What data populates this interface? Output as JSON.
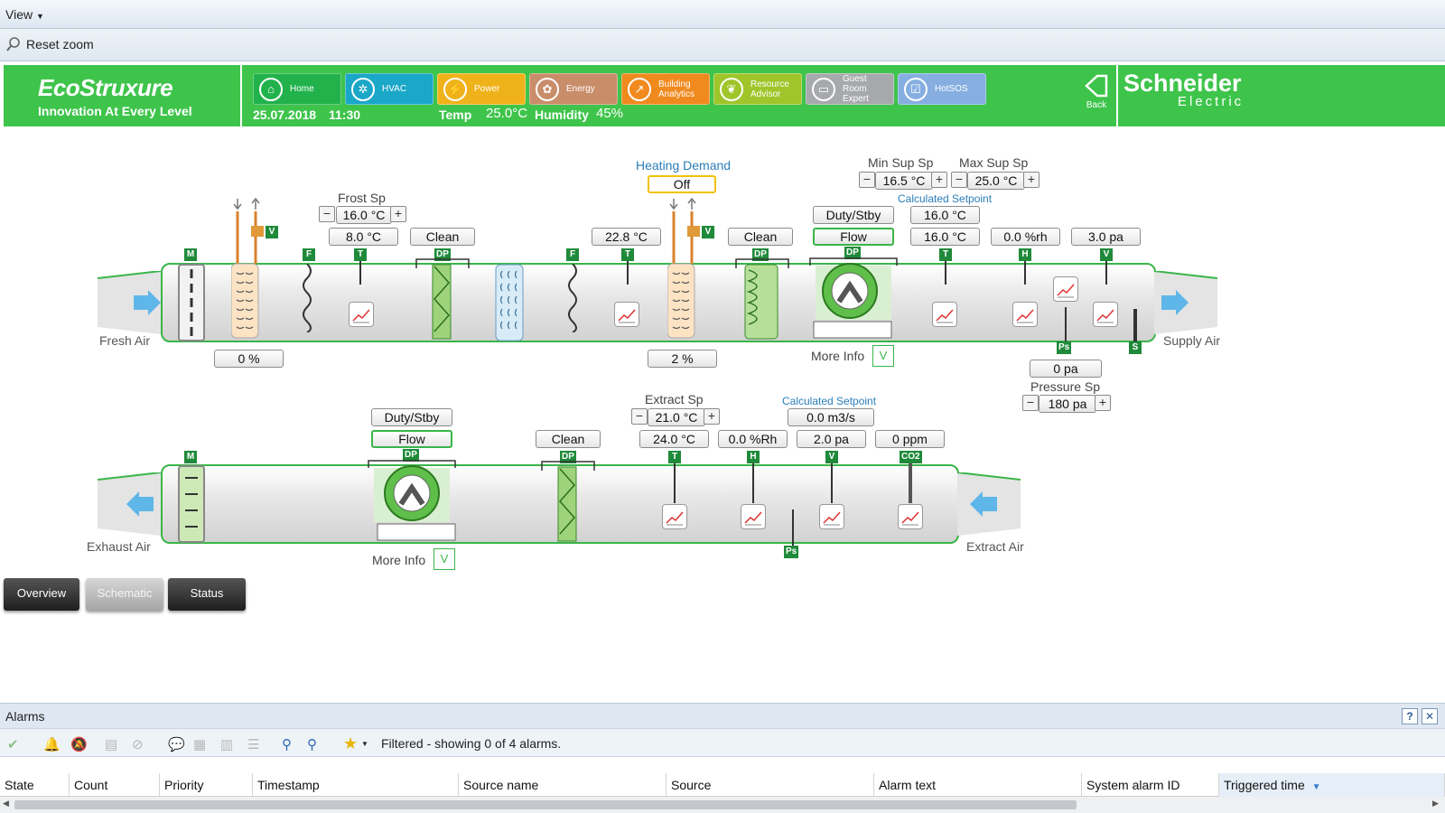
{
  "menu": {
    "view_label": "View"
  },
  "toolbar": {
    "reset_zoom_label": "Reset zoom"
  },
  "header": {
    "logo_main": "EcoStruxure",
    "logo_sub": "Innovation At Every Level",
    "date": "25.07.2018",
    "time": "11:30",
    "temp_label": "Temp",
    "temp_value": "25.0°C",
    "humidity_label": "Humidity",
    "humidity_value": "45%",
    "back_label": "Back",
    "brand_line1": "Schneider",
    "brand_line2": "Electric",
    "nav": [
      {
        "label": "Home",
        "icon": "home-icon",
        "color": "#22b24c"
      },
      {
        "label": "HVAC",
        "icon": "fan-icon",
        "color": "#1ba7c7"
      },
      {
        "label": "Power",
        "icon": "plug-icon",
        "color": "#f0b21a"
      },
      {
        "label": "Energy",
        "icon": "energy-icon",
        "color": "#c98d6a"
      },
      {
        "label": "Building Analytics",
        "icon": "chart-icon",
        "color": "#f08a1e"
      },
      {
        "label": "Resource Advisor",
        "icon": "leaf-icon",
        "color": "#9fc52a"
      },
      {
        "label": "Guest Room Expert",
        "icon": "bed-icon",
        "color": "#a7a9ac"
      },
      {
        "label": "HotSOS",
        "icon": "checkbox-icon",
        "color": "#86aee0"
      }
    ]
  },
  "supply": {
    "frost_sp_label": "Frost Sp",
    "frost_sp": "16.0 °C",
    "frost_temp": "8.0 °C",
    "clean1": "Clean",
    "damper_pct": "0 %",
    "heating_demand_label": "Heating Demand",
    "heating_demand": "Off",
    "temp2": "22.8 °C",
    "heat_valve_pct": "2 %",
    "clean2": "Clean",
    "duty_stby": "Duty/Stby",
    "flow": "Flow",
    "more_info": "More Info",
    "min_sup_sp_label": "Min Sup Sp",
    "min_sup_sp": "16.5 °C",
    "max_sup_sp_label": "Max Sup Sp",
    "max_sup_sp": "25.0 °C",
    "calc_sp_label": "Calculated Setpoint",
    "calc_sp": "16.0 °C",
    "supply_temp": "16.0 °C",
    "supply_rh": "0.0 %rh",
    "supply_vp": "3.0 pa",
    "pressure": "0 pa",
    "pressure_sp_label": "Pressure Sp",
    "pressure_sp": "180 pa",
    "fresh_air": "Fresh Air",
    "supply_air": "Supply Air"
  },
  "extract": {
    "duty_stby": "Duty/Stby",
    "flow": "Flow",
    "more_info": "More Info",
    "clean": "Clean",
    "extract_sp_label": "Extract Sp",
    "extract_sp": "21.0 °C",
    "temp": "24.0 °C",
    "rh": "0.0 %Rh",
    "calc_sp_label": "Calculated Setpoint",
    "calc_flow": "0.0 m3/s",
    "vp": "2.0 pa",
    "co2": "0 ppm",
    "exhaust_air": "Exhaust Air",
    "extract_air": "Extract Air"
  },
  "tags": {
    "m": "M",
    "f": "F",
    "t": "T",
    "dp": "DP",
    "v": "V",
    "h": "H",
    "ps": "Ps",
    "s": "S",
    "co2": "CO2"
  },
  "tabs": {
    "overview": "Overview",
    "schematic": "Schematic",
    "status": "Status"
  },
  "alarms": {
    "title": "Alarms",
    "help": "?",
    "close": "✕",
    "filter_text": "Filtered - showing 0 of 4 alarms.",
    "columns": [
      "State",
      "Count",
      "Priority",
      "Timestamp",
      "Source name",
      "Source",
      "Alarm text",
      "System alarm ID",
      "Triggered time"
    ]
  }
}
